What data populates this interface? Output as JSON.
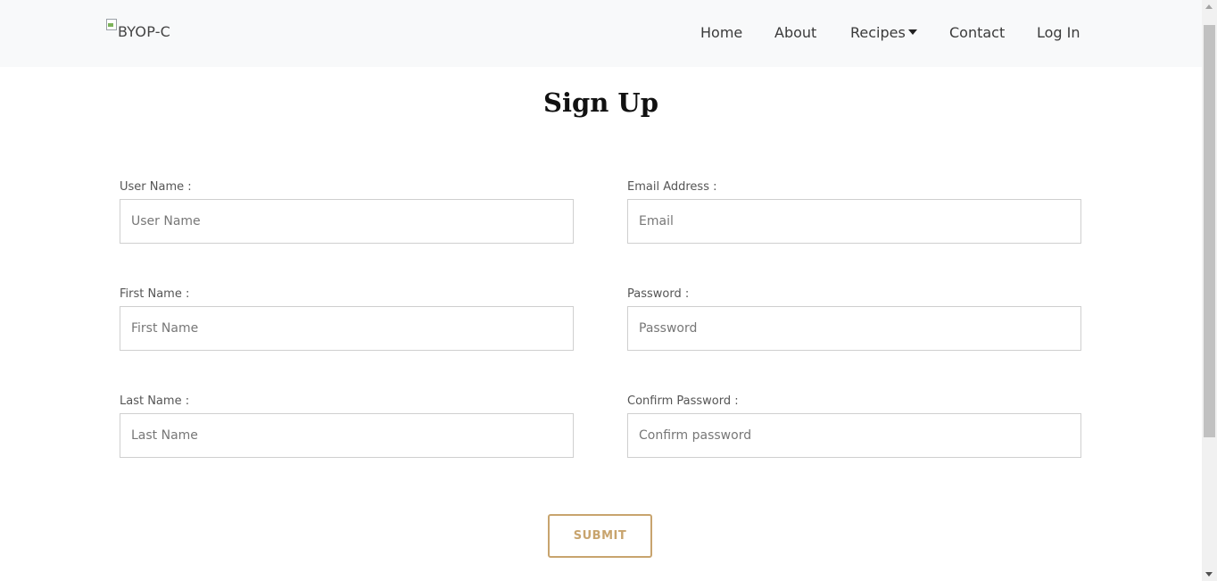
{
  "navbar": {
    "brand_alt": "BYOP-C",
    "links": [
      {
        "label": "Home"
      },
      {
        "label": "About"
      },
      {
        "label": "Recipes"
      },
      {
        "label": "Contact"
      },
      {
        "label": "Log In"
      }
    ],
    "background": "#f8f9fa"
  },
  "page": {
    "title": "Sign Up"
  },
  "form": {
    "username": {
      "label": "User Name :",
      "placeholder": "User Name",
      "value": ""
    },
    "email": {
      "label": "Email Address :",
      "placeholder": "Email",
      "value": ""
    },
    "first_name": {
      "label": "First Name :",
      "placeholder": "First Name",
      "value": ""
    },
    "password": {
      "label": "Password :",
      "placeholder": "Password",
      "value": ""
    },
    "last_name": {
      "label": "Last Name :",
      "placeholder": "Last Name",
      "value": ""
    },
    "confirm_password": {
      "label": "Confirm Password :",
      "placeholder": "Confirm password",
      "value": ""
    },
    "submit_label": "SUBMIT"
  },
  "colors": {
    "accent": "#c8a46e",
    "input_border": "#cfcfcf"
  },
  "icons": {
    "brand": "broken-image-icon",
    "recipes_dropdown": "caret-down-icon"
  }
}
